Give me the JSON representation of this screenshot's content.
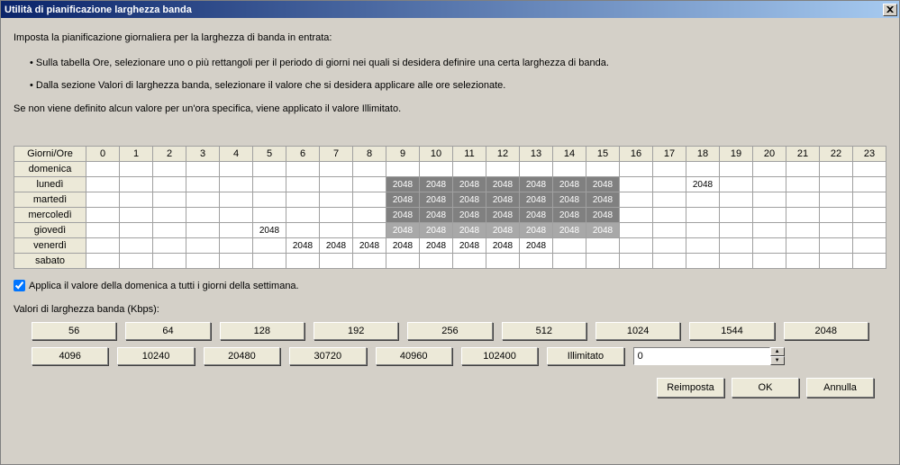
{
  "title": "Utilità di pianificazione larghezza banda",
  "intro": {
    "line1": "Imposta la pianificazione giornaliera per la larghezza di banda in entrata:",
    "bullet1": "Sulla tabella Ore, selezionare uno o più rettangoli per il periodo di giorni nei quali si desidera definire una certa larghezza di banda.",
    "bullet2": "Dalla sezione Valori di larghezza banda, selezionare il valore che si desidera applicare alle ore selezionate.",
    "line2": "Se non viene definito alcun valore per un'ora specifica, viene applicato il valore Illimitato."
  },
  "schedule": {
    "corner": "Giorni/Ore",
    "hours": [
      "0",
      "1",
      "2",
      "3",
      "4",
      "5",
      "6",
      "7",
      "8",
      "9",
      "10",
      "11",
      "12",
      "13",
      "14",
      "15",
      "16",
      "17",
      "18",
      "19",
      "20",
      "21",
      "22",
      "23"
    ],
    "days": [
      "domenica",
      "lunedì",
      "martedì",
      "mercoledì",
      "giovedì",
      "venerdì",
      "sabato"
    ],
    "data": {
      "lunedì": {
        "9": {
          "v": "2048",
          "s": 1
        },
        "10": {
          "v": "2048",
          "s": 1
        },
        "11": {
          "v": "2048",
          "s": 1
        },
        "12": {
          "v": "2048",
          "s": 1
        },
        "13": {
          "v": "2048",
          "s": 1
        },
        "14": {
          "v": "2048",
          "s": 1
        },
        "15": {
          "v": "2048",
          "s": 1
        },
        "18": {
          "v": "2048",
          "s": 0
        }
      },
      "martedì": {
        "9": {
          "v": "2048",
          "s": 1
        },
        "10": {
          "v": "2048",
          "s": 1
        },
        "11": {
          "v": "2048",
          "s": 1
        },
        "12": {
          "v": "2048",
          "s": 1
        },
        "13": {
          "v": "2048",
          "s": 1
        },
        "14": {
          "v": "2048",
          "s": 1
        },
        "15": {
          "v": "2048",
          "s": 1
        }
      },
      "mercoledì": {
        "9": {
          "v": "2048",
          "s": 1
        },
        "10": {
          "v": "2048",
          "s": 1
        },
        "11": {
          "v": "2048",
          "s": 1
        },
        "12": {
          "v": "2048",
          "s": 1
        },
        "13": {
          "v": "2048",
          "s": 1
        },
        "14": {
          "v": "2048",
          "s": 1
        },
        "15": {
          "v": "2048",
          "s": 1
        }
      },
      "giovedì": {
        "5": {
          "v": "2048",
          "s": 0
        },
        "9": {
          "v": "2048",
          "s": 2
        },
        "10": {
          "v": "2048",
          "s": 2
        },
        "11": {
          "v": "2048",
          "s": 2
        },
        "12": {
          "v": "2048",
          "s": 2
        },
        "13": {
          "v": "2048",
          "s": 2
        },
        "14": {
          "v": "2048",
          "s": 2
        },
        "15": {
          "v": "2048",
          "s": 2
        }
      },
      "venerdì": {
        "6": {
          "v": "2048",
          "s": 0
        },
        "7": {
          "v": "2048",
          "s": 0
        },
        "8": {
          "v": "2048",
          "s": 0
        },
        "9": {
          "v": "2048",
          "s": 0
        },
        "10": {
          "v": "2048",
          "s": 0
        },
        "11": {
          "v": "2048",
          "s": 0
        },
        "12": {
          "v": "2048",
          "s": 0
        },
        "13": {
          "v": "2048",
          "s": 0
        }
      }
    }
  },
  "checkbox": {
    "checked": true,
    "label": "Applica il valore della domenica a tutti i giorni della settimana."
  },
  "valuesLabel": "Valori di larghezza banda (Kbps):",
  "bwRow1": [
    "56",
    "64",
    "128",
    "192",
    "256",
    "512",
    "1024",
    "1544",
    "2048"
  ],
  "bwRow2": [
    "4096",
    "10240",
    "20480",
    "30720",
    "40960",
    "102400",
    "Illimitato"
  ],
  "spinnerValue": "0",
  "footer": {
    "reset": "Reimposta",
    "ok": "OK",
    "cancel": "Annulla"
  }
}
